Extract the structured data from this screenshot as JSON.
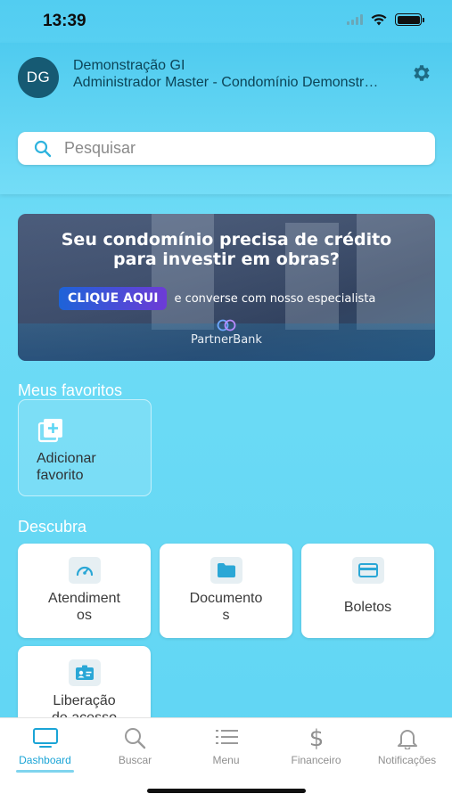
{
  "status_bar": {
    "time": "13:39"
  },
  "header": {
    "avatar_initials": "DG",
    "user_name": "Demonstração GI",
    "user_role": "Administrador Master - Condomínio Demonstração",
    "search_placeholder": "Pesquisar"
  },
  "banner": {
    "title_line1": "Seu condomínio precisa de crédito",
    "title_line2": "para investir em obras?",
    "cta": "CLIQUE AQUI",
    "subtitle": "e converse com nosso especialista",
    "logo_text": "PartnerBank"
  },
  "favorites": {
    "title": "Meus favoritos",
    "add_label_line1": "Adicionar",
    "add_label_line2": "favorito"
  },
  "discover": {
    "title": "Descubra",
    "tiles": [
      {
        "label_line1": "Atendiment",
        "label_line2": "os",
        "icon": "speedometer-icon"
      },
      {
        "label_line1": "Documento",
        "label_line2": "s",
        "icon": "folder-icon"
      },
      {
        "label_line1": "Boletos",
        "label_line2": "",
        "icon": "card-icon"
      },
      {
        "label_line1": "Liberação",
        "label_line2": "de acesso",
        "icon": "badge-icon"
      }
    ]
  },
  "tabbar": {
    "tabs": [
      {
        "label": "Dashboard",
        "active": true
      },
      {
        "label": "Buscar",
        "active": false
      },
      {
        "label": "Menu",
        "active": false
      },
      {
        "label": "Financeiro",
        "active": false
      },
      {
        "label": "Notificações",
        "active": false
      }
    ]
  },
  "colors": {
    "accent": "#1aa4d6",
    "avatar_bg": "#165a73",
    "background": "#5dd6f4"
  }
}
